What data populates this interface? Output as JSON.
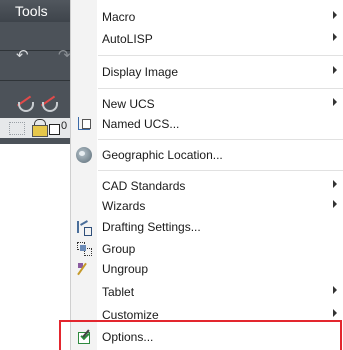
{
  "background_app": {
    "menubar_label": "Tools",
    "layer_value": "0"
  },
  "menu": {
    "items": [
      {
        "label": "Macro",
        "submenu": true
      },
      {
        "label": "AutoLISP",
        "submenu": true
      },
      {
        "label": "Display Image",
        "submenu": true
      },
      {
        "label": "New UCS",
        "submenu": true
      },
      {
        "label": "Named UCS...",
        "icon": "named-ucs-icon"
      },
      {
        "label": "Geographic Location...",
        "icon": "globe-icon"
      },
      {
        "label": "CAD Standards",
        "submenu": true
      },
      {
        "label": "Wizards",
        "submenu": true
      },
      {
        "label": "Drafting Settings...",
        "icon": "drafting-settings-icon"
      },
      {
        "label": "Group",
        "icon": "group-icon"
      },
      {
        "label": "Ungroup",
        "icon": "ungroup-icon"
      },
      {
        "label": "Tablet",
        "submenu": true
      },
      {
        "label": "Customize",
        "submenu": true
      },
      {
        "label": "Options...",
        "icon": "options-icon",
        "highlighted": true
      }
    ]
  },
  "colors": {
    "highlight_border": "#e3262e",
    "menubar": "#4a5057"
  }
}
